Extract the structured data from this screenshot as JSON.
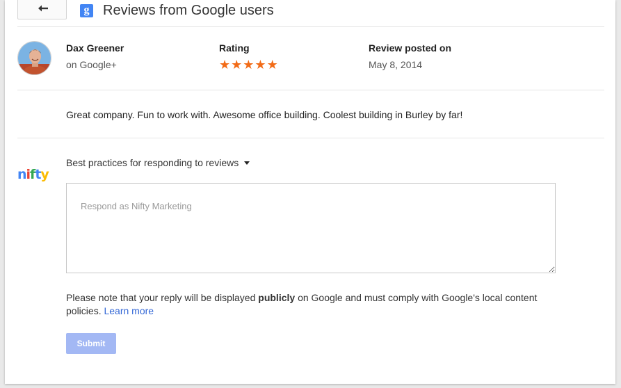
{
  "header": {
    "back_icon": "back-arrow-icon",
    "brand_icon": "google-plus-icon",
    "brand_icon_glyph": "g",
    "title": "Reviews from Google users"
  },
  "review": {
    "reviewer_name": "Dax Greener",
    "reviewer_source": "on Google+",
    "rating_label": "Rating",
    "rating_value": 5,
    "rating_max": 5,
    "posted_label": "Review posted on",
    "posted_date": "May 8, 2014",
    "text": "Great company. Fun to work with. Awesome office building. Coolest building in Burley by far!"
  },
  "response": {
    "logo_text": "nifty",
    "best_practices_label": "Best practices for responding to reviews",
    "placeholder": "Respond as Nifty Marketing",
    "value": "",
    "note_before": "Please note that your reply will be displayed ",
    "note_bold": "publicly",
    "note_after": " on Google and must comply with Google's local content policies.",
    "learn_more": "Learn more",
    "submit_label": "Submit"
  },
  "colors": {
    "star": "#f26b17",
    "google_blue": "#4285f4",
    "link": "#3367d6",
    "submit_disabled": "#a3b8f4"
  }
}
